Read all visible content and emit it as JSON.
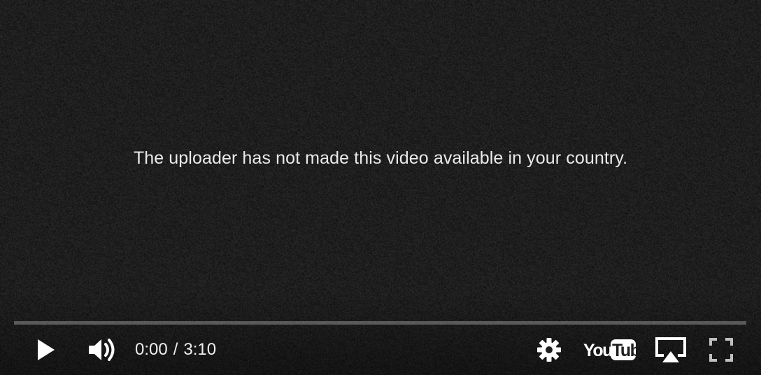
{
  "player": {
    "message": "The uploader has not made this video available in your country.",
    "progress_fraction": 0,
    "time": {
      "current": "0:00",
      "separator": "/",
      "duration": "3:10"
    },
    "controls": {
      "play_icon": "play-icon",
      "volume_icon": "volume-icon",
      "settings_icon": "gear-icon",
      "logo_icon": "youtube-logo-icon",
      "airplay_icon": "airplay-icon",
      "fullscreen_icon": "fullscreen-icon"
    },
    "colors": {
      "background": "#1c1c1c",
      "text": "#eaeaea",
      "icon": "#ffffff",
      "progress_track": "#5a5a5a"
    }
  }
}
